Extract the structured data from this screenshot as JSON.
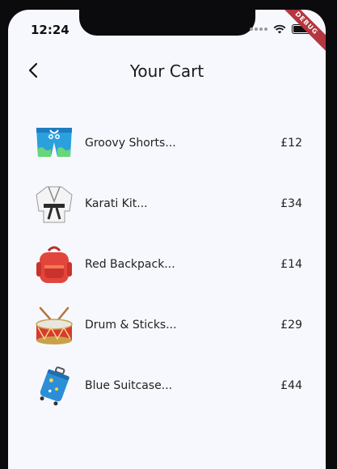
{
  "status": {
    "time": "12:24",
    "ribbon": "DEBUG"
  },
  "appbar": {
    "title": "Your Cart"
  },
  "cart": {
    "items": [
      {
        "name": "Groovy Shorts...",
        "price": "£12",
        "icon": "swim-shorts-icon"
      },
      {
        "name": "Karati Kit...",
        "price": "£34",
        "icon": "martial-arts-uniform-icon"
      },
      {
        "name": "Red Backpack...",
        "price": "£14",
        "icon": "backpack-icon"
      },
      {
        "name": "Drum & Sticks...",
        "price": "£29",
        "icon": "drum-icon"
      },
      {
        "name": "Blue Suitcase...",
        "price": "£44",
        "icon": "suitcase-icon"
      }
    ]
  },
  "colors": {
    "background": "#f7f8fd",
    "ribbon": "#b5363f",
    "text": "#222222"
  }
}
